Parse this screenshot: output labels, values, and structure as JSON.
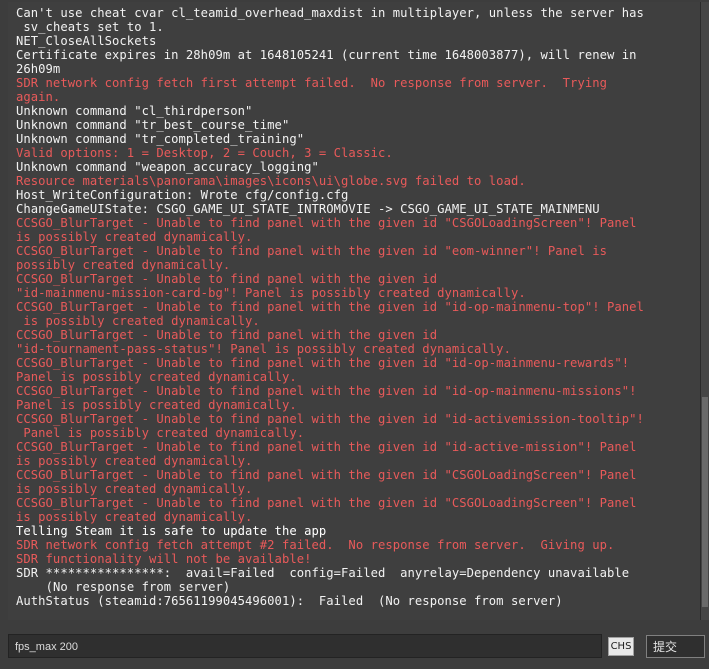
{
  "console": {
    "lines": [
      {
        "text": "Can't use cheat cvar cl_teamid_overhead_maxdist in multiplayer, unless the server has\n sv_cheats set to 1.",
        "type": "normal"
      },
      {
        "text": "NET_CloseAllSockets",
        "type": "normal"
      },
      {
        "text": "Certificate expires in 28h09m at 1648105241 (current time 1648003877), will renew in\n26h09m",
        "type": "normal"
      },
      {
        "text": "SDR network config fetch first attempt failed.  No response from server.  Trying\nagain.",
        "type": "error"
      },
      {
        "text": "Unknown command \"cl_thirdperson\"",
        "type": "normal"
      },
      {
        "text": "Unknown command \"tr_best_course_time\"",
        "type": "normal"
      },
      {
        "text": "Unknown command \"tr_completed_training\"",
        "type": "normal"
      },
      {
        "text": "Valid options: 1 = Desktop, 2 = Couch, 3 = Classic.",
        "type": "error"
      },
      {
        "text": "Unknown command \"weapon_accuracy_logging\"",
        "type": "normal"
      },
      {
        "text": "Resource materials\\panorama\\images\\icons\\ui\\globe.svg failed to load.",
        "type": "error"
      },
      {
        "text": "Host_WriteConfiguration: Wrote cfg/config.cfg",
        "type": "normal"
      },
      {
        "text": "ChangeGameUIState: CSGO_GAME_UI_STATE_INTROMOVIE -> CSGO_GAME_UI_STATE_MAINMENU",
        "type": "normal"
      },
      {
        "text": "CCSGO_BlurTarget - Unable to find panel with the given id \"CSGOLoadingScreen\"! Panel\nis possibly created dynamically.",
        "type": "error"
      },
      {
        "text": "CCSGO_BlurTarget - Unable to find panel with the given id \"eom-winner\"! Panel is\npossibly created dynamically.",
        "type": "error"
      },
      {
        "text": "CCSGO_BlurTarget - Unable to find panel with the given id\n\"id-mainmenu-mission-card-bg\"! Panel is possibly created dynamically.",
        "type": "error"
      },
      {
        "text": "CCSGO_BlurTarget - Unable to find panel with the given id \"id-op-mainmenu-top\"! Panel\n is possibly created dynamically.",
        "type": "error"
      },
      {
        "text": "CCSGO_BlurTarget - Unable to find panel with the given id\n\"id-tournament-pass-status\"! Panel is possibly created dynamically.",
        "type": "error"
      },
      {
        "text": "CCSGO_BlurTarget - Unable to find panel with the given id \"id-op-mainmenu-rewards\"!\nPanel is possibly created dynamically.",
        "type": "error"
      },
      {
        "text": "CCSGO_BlurTarget - Unable to find panel with the given id \"id-op-mainmenu-missions\"!\nPanel is possibly created dynamically.",
        "type": "error"
      },
      {
        "text": "CCSGO_BlurTarget - Unable to find panel with the given id \"id-activemission-tooltip\"!\n Panel is possibly created dynamically.",
        "type": "error"
      },
      {
        "text": "CCSGO_BlurTarget - Unable to find panel with the given id \"id-active-mission\"! Panel\nis possibly created dynamically.",
        "type": "error"
      },
      {
        "text": "CCSGO_BlurTarget - Unable to find panel with the given id \"CSGOLoadingScreen\"! Panel\nis possibly created dynamically.",
        "type": "error"
      },
      {
        "text": "CCSGO_BlurTarget - Unable to find panel with the given id \"CSGOLoadingScreen\"! Panel\nis possibly created dynamically.",
        "type": "error"
      },
      {
        "text": "Telling Steam it is safe to update the app",
        "type": "strong"
      },
      {
        "text": "SDR network config fetch attempt #2 failed.  No response from server.  Giving up.\nSDR functionality will not be available!",
        "type": "error"
      },
      {
        "text": "SDR ****************:  avail=Failed  config=Failed  anyrelay=Dependency unavailable\n    (No response from server)",
        "type": "normal"
      },
      {
        "text": "AuthStatus (steamid:76561199045496001):  Failed  (No response from server)",
        "type": "normal"
      }
    ]
  },
  "input": {
    "value": "fps_max 200"
  },
  "ime_badge": "CHS",
  "submit_label": "提交"
}
